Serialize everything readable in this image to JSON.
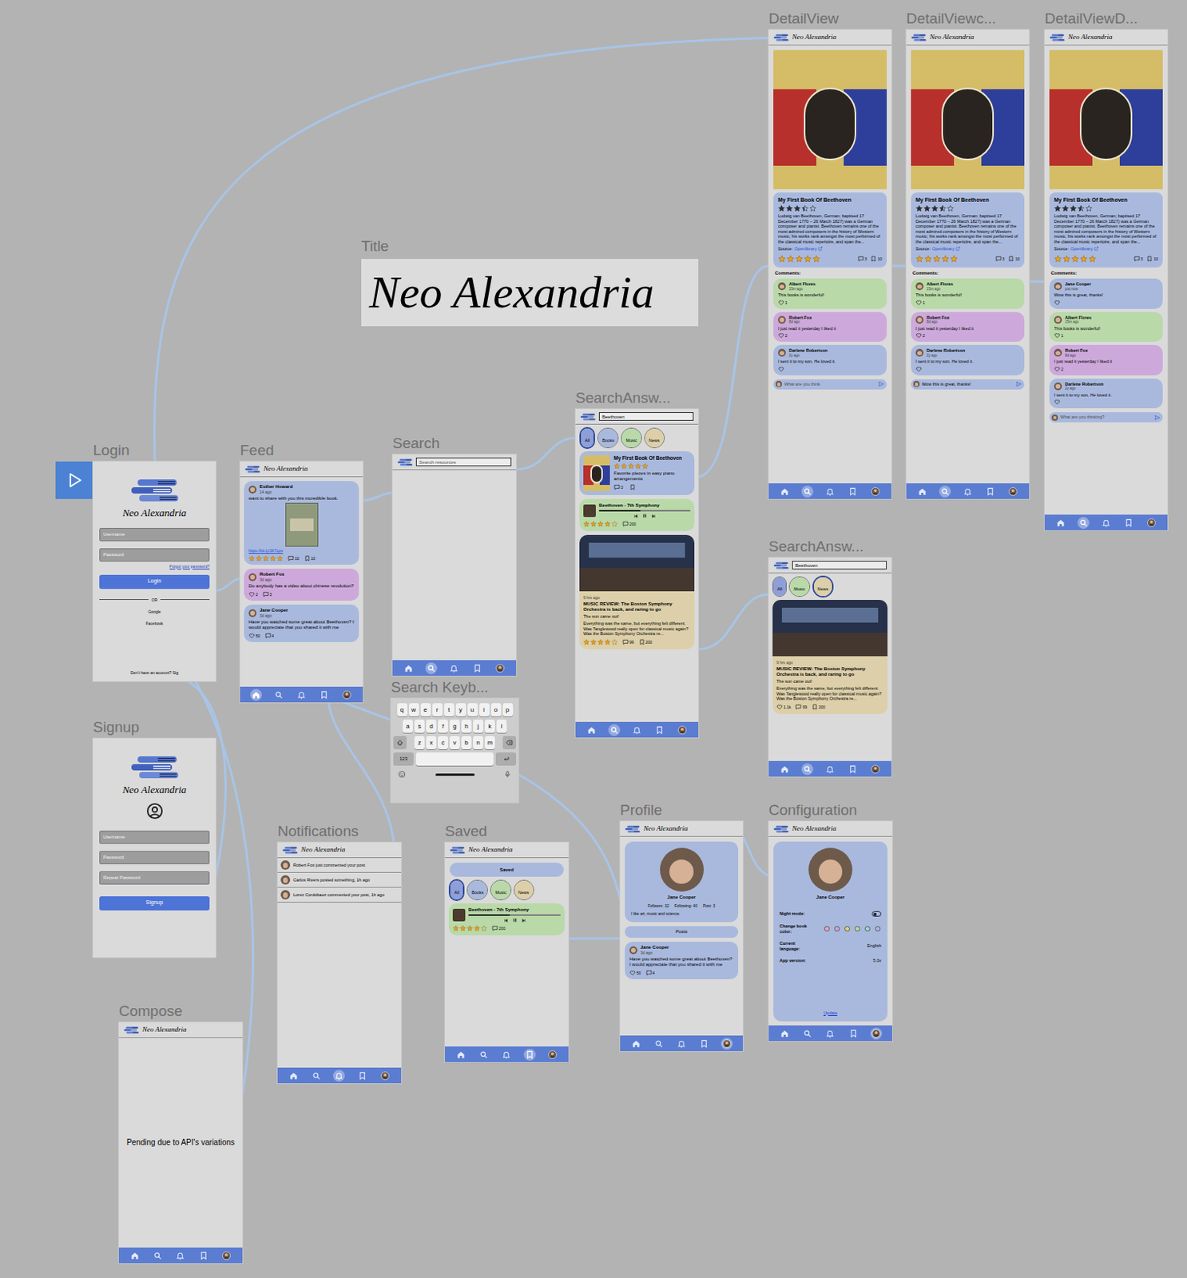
{
  "title": {
    "label": "Title",
    "text": "Neo Alexandria"
  },
  "brand": "Neo Alexandria",
  "frames": [
    {
      "kind": "login",
      "label": "Login",
      "fields": [
        "Username",
        "Password"
      ],
      "forgot": "Forgot your password?",
      "button": "Login",
      "divider": "OR",
      "providers": [
        "Google",
        "Facebook"
      ],
      "footer": "Don't have an account? Sig"
    },
    {
      "kind": "feed",
      "label": "Feed",
      "posts": [
        {
          "kind": "image",
          "author": "Esther Howard",
          "time": "14 ago",
          "text": "want to share with you this incredible book.",
          "link": "https://bit.ly/3KTqov",
          "stars": 5,
          "comments": "10",
          "saves": "10",
          "color": "#a9b9de"
        },
        {
          "kind": "text",
          "author": "Robert Fox",
          "time": "3d ago",
          "text": "Do anybody has a video about chinese revolution?",
          "likes": "2",
          "comments": "3",
          "color": "#cda9db"
        },
        {
          "kind": "text",
          "author": "Jane Cooper",
          "time": "3d ago",
          "text": "Have you watched some great about Beethoven? I would appreciate that you shared it with me",
          "likes": "50",
          "comments": "4",
          "color": "#a9b9de"
        }
      ],
      "nav": [
        {
          "kind": "home",
          "selected": true
        },
        {
          "kind": "search",
          "selected": false
        },
        {
          "kind": "bell",
          "selected": false
        },
        {
          "kind": "bookmark",
          "selected": false
        },
        {
          "kind": "profile",
          "selected": false
        }
      ]
    },
    {
      "kind": "search",
      "label": "Search",
      "placeholder": "Search resources",
      "nav": [
        {
          "kind": "home",
          "selected": false
        },
        {
          "kind": "search",
          "selected": true
        },
        {
          "kind": "bell",
          "selected": false
        },
        {
          "kind": "bookmark",
          "selected": false
        },
        {
          "kind": "profile",
          "selected": false
        }
      ]
    },
    {
      "kind": "keyboard",
      "label": "Search Keyb...",
      "rows": [
        [
          "q",
          "w",
          "e",
          "r",
          "t",
          "y",
          "u",
          "i",
          "o",
          "p"
        ],
        [
          "a",
          "s",
          "d",
          "f",
          "g",
          "h",
          "j",
          "k",
          "l"
        ],
        [
          "z",
          "x",
          "c",
          "v",
          "b",
          "n",
          "m"
        ]
      ],
      "numbers": "123"
    },
    {
      "kind": "results",
      "label": "SearchAnsw...",
      "query": "Beethoven",
      "filters": [
        {
          "label": "All",
          "selected": true,
          "color": "#8e9fd8"
        },
        {
          "label": "Books",
          "selected": false,
          "color": "#a9b9de"
        },
        {
          "label": "Music",
          "selected": false,
          "color": "#b9d9a9"
        },
        {
          "label": "News",
          "selected": false,
          "color": "#dccfa9"
        }
      ],
      "results": [
        {
          "kind": "book",
          "title": "My First Book Of Beethoven",
          "stars": 5,
          "subtitle": "Favorite pieces in easy piano arrangements",
          "comments": "3",
          "color": "#a9b9de"
        },
        {
          "kind": "music",
          "title": "Beethoven - 7th Symphony",
          "level": 0.45,
          "stars": 4,
          "comments": "200",
          "color": "#b9d9a9"
        },
        {
          "kind": "news",
          "time": "9 hrs ago",
          "title": "MUSIC REVIEW: The Boston Symphony Orchestra is back, and raring to go",
          "subtitle": "The sun came out!",
          "body": "Everything was the same, but everything felt different. Was Tanglewood really open for classical music again? Was the Boston Symphony Orchestra re...",
          "stars": 4,
          "comments": "99",
          "saves": "200",
          "color": "#dccfa9"
        }
      ],
      "nav": [
        {
          "kind": "home",
          "selected": false
        },
        {
          "kind": "search",
          "selected": true
        },
        {
          "kind": "bell",
          "selected": false
        },
        {
          "kind": "bookmark",
          "selected": false
        },
        {
          "kind": "profile",
          "selected": false
        }
      ]
    },
    {
      "kind": "detail",
      "label": "DetailView",
      "title": "My First Book Of Beethoven",
      "rating": 3.5,
      "description": "Ludwig van Beethoven, German; baptised 17 December 1770 – 26 March 1827) was a German composer and pianist. Beethoven remains one of the most admired composers in the history of Western music; his works rank amongst the most performed of the classical music repertoire, and span the...",
      "source_label": "Source:",
      "source": "Openlibrary",
      "my_stars": 5,
      "comments": "3",
      "saves": "10",
      "comments_label": "Comments:",
      "comment_list": [
        {
          "author": "Albert Flores",
          "time": "15m ago",
          "text": "This books is wonderful!",
          "likes": "1",
          "color": "#b9d9a9"
        },
        {
          "author": "Robert Fox",
          "time": "8d ago",
          "text": "I just read it yesterday I liked it",
          "likes": "2",
          "color": "#cda9db"
        },
        {
          "author": "Darlene Robertson",
          "time": "2y ago",
          "text": "I sent it to my son, He loved it.",
          "color": "#a9b9de"
        }
      ],
      "input": {
        "text": "What are you think",
        "placeholder": true
      },
      "nav": [
        {
          "kind": "home",
          "selected": false
        },
        {
          "kind": "search",
          "selected": true
        },
        {
          "kind": "bell",
          "selected": false
        },
        {
          "kind": "bookmark",
          "selected": false
        },
        {
          "kind": "profile",
          "selected": false
        }
      ]
    },
    {
      "kind": "detail",
      "label": "DetailViewc...",
      "title": "My First Book Of Beethoven",
      "rating": 3.5,
      "description": "Ludwig van Beethoven, German; baptised 17 December 1770 – 26 March 1827) was a German composer and pianist. Beethoven remains one of the most admired composers in the history of Western music; his works rank amongst the most performed of the classical music repertoire, and span the...",
      "source_label": "Source:",
      "source": "Openlibrary",
      "my_stars": 5,
      "comments": "3",
      "saves": "10",
      "comments_label": "Comments:",
      "comment_list": [
        {
          "author": "Albert Flores",
          "time": "15m ago",
          "text": "This books is wonderful!",
          "likes": "1",
          "color": "#b9d9a9"
        },
        {
          "author": "Robert Fox",
          "time": "8d ago",
          "text": "I just read it yesterday I liked it",
          "likes": "2",
          "color": "#cda9db"
        },
        {
          "author": "Darlene Robertson",
          "time": "2y ago",
          "text": "I sent it to my son, He loved it.",
          "color": "#a9b9de"
        }
      ],
      "input": {
        "text": "Wow this is great, thanks!",
        "placeholder": false
      },
      "nav": [
        {
          "kind": "home",
          "selected": false
        },
        {
          "kind": "search",
          "selected": true
        },
        {
          "kind": "bell",
          "selected": false
        },
        {
          "kind": "bookmark",
          "selected": false
        },
        {
          "kind": "profile",
          "selected": false
        }
      ]
    },
    {
      "kind": "detail",
      "label": "DetailViewD...",
      "title": "My First Book Of Beethoven",
      "rating": 3.5,
      "description": "Ludwig van Beethoven, German; baptised 17 December 1770 – 26 March 1827) was a German composer and pianist. Beethoven remains one of the most admired composers in the history of Western music; his works rank amongst the most performed of the classical music repertoire, and span the...",
      "source_label": "Source:",
      "source": "Openlibrary",
      "my_stars": 5,
      "comments": "3",
      "saves": "10",
      "comments_label": "Comments:",
      "comment_list": [
        {
          "author": "Jane Cooper",
          "time": "just now",
          "text": "Wow this is great, thanks!",
          "color": "#a9b9de"
        },
        {
          "author": "Albert Flores",
          "time": "15m ago",
          "text": "This books is wonderful!",
          "likes": "1",
          "color": "#b9d9a9"
        },
        {
          "author": "Robert Fox",
          "time": "8d ago",
          "text": "I just read it yesterday I liked it",
          "likes": "2",
          "color": "#cda9db"
        },
        {
          "author": "Darlene Robertson",
          "time": "2y ago",
          "text": "I sent it to my son, He loved it.",
          "color": "#a9b9de"
        }
      ],
      "input": {
        "text": "What are you thinking?",
        "placeholder": true
      },
      "nav": [
        {
          "kind": "home",
          "selected": false
        },
        {
          "kind": "search",
          "selected": true
        },
        {
          "kind": "bell",
          "selected": false
        },
        {
          "kind": "bookmark",
          "selected": false
        },
        {
          "kind": "profile",
          "selected": false
        }
      ]
    },
    {
      "kind": "results",
      "label": "SearchAnsw...",
      "query": "Beethoven",
      "filters": [
        {
          "label": "All",
          "selected": false,
          "color": "#8e9fd8"
        },
        {
          "label": "Music",
          "selected": false,
          "color": "#b9d9a9"
        },
        {
          "label": "News",
          "selected": true,
          "color": "#dccfa9"
        }
      ],
      "results": [
        {
          "kind": "news",
          "time": "9 hrs ago",
          "title": "MUSIC REVIEW: The Boston Symphony Orchestra is back, and raring to go",
          "subtitle": "The sun came out!",
          "body": "Everything was the same, but everything felt different. Was Tanglewood really open for classical music again? Was the Boston Symphony Orchestra re...",
          "likes": "1.1k",
          "comments": "99",
          "saves": "200",
          "color": "#dccfa9"
        }
      ],
      "nav": [
        {
          "kind": "home",
          "selected": false
        },
        {
          "kind": "search",
          "selected": true
        },
        {
          "kind": "bell",
          "selected": false
        },
        {
          "kind": "bookmark",
          "selected": false
        },
        {
          "kind": "profile",
          "selected": false
        }
      ]
    },
    {
      "kind": "signup",
      "label": "Signup",
      "fields": [
        "Username",
        "Password",
        "Repeat Password"
      ],
      "button": "Signup"
    },
    {
      "kind": "compose",
      "label": "Compose",
      "message": "Pending due to API's variations",
      "nav": [
        {
          "kind": "home",
          "selected": false
        },
        {
          "kind": "search",
          "selected": false
        },
        {
          "kind": "bell",
          "selected": false
        },
        {
          "kind": "bookmark",
          "selected": false
        },
        {
          "kind": "profile",
          "selected": false
        }
      ]
    },
    {
      "kind": "notifications",
      "label": "Notifications",
      "items": [
        {
          "text": "Robert Fox just commented your post"
        },
        {
          "text": "Carlos Rivers posted something, 1h ago"
        },
        {
          "text": "Lorez Cordobaez commented your post, 1h ago"
        }
      ],
      "nav": [
        {
          "kind": "home",
          "selected": false
        },
        {
          "kind": "search",
          "selected": false
        },
        {
          "kind": "bell",
          "selected": true
        },
        {
          "kind": "bookmark",
          "selected": false
        },
        {
          "kind": "profile",
          "selected": false
        }
      ]
    },
    {
      "kind": "saved",
      "label": "Saved",
      "heading": "Saved",
      "filters": [
        {
          "label": "All",
          "selected": true,
          "color": "#8e9fd8"
        },
        {
          "label": "Books",
          "selected": false,
          "color": "#a9b9de"
        },
        {
          "label": "Music",
          "selected": false,
          "color": "#b9d9a9"
        },
        {
          "label": "News",
          "selected": false,
          "color": "#dccfa9"
        }
      ],
      "items": [
        {
          "kind": "music",
          "title": "Beethoven - 7th Symphony",
          "level": 0.45,
          "stars": 4,
          "comments": "200",
          "color": "#b9d9a9"
        }
      ],
      "nav": [
        {
          "kind": "home",
          "selected": false
        },
        {
          "kind": "search",
          "selected": false
        },
        {
          "kind": "bell",
          "selected": false
        },
        {
          "kind": "bookmark",
          "selected": true
        },
        {
          "kind": "profile",
          "selected": false
        }
      ]
    },
    {
      "kind": "profile",
      "label": "Profile",
      "name": "Jane Cooper",
      "stats": [
        "Follwers: 32",
        "Following: 40",
        "Post: 3"
      ],
      "bio": "I like art, music and science.",
      "section": "Posts",
      "posts": [
        {
          "kind": "text",
          "author": "Jane Cooper",
          "time": "3d ago",
          "text": "Have you watched some great about Beethoven? I would appreciate that you shared it with me",
          "likes": "50",
          "comments": "4",
          "color": "#a9b9de"
        }
      ],
      "nav": [
        {
          "kind": "home",
          "selected": false
        },
        {
          "kind": "search",
          "selected": false
        },
        {
          "kind": "bell",
          "selected": false
        },
        {
          "kind": "bookmark",
          "selected": false
        },
        {
          "kind": "profile",
          "selected": true
        }
      ]
    },
    {
      "kind": "configuration",
      "label": "Configuration",
      "name": "Jane Cooper",
      "night_mode": {
        "label": "Night mode:",
        "on": false
      },
      "book_color": {
        "label": "Change book color:",
        "options": [
          {
            "color": "#e8a7c8",
            "selected": false
          },
          {
            "color": "#c9a8e0",
            "selected": false
          },
          {
            "color": "#e6d27a",
            "selected": false
          },
          {
            "color": "#b7dca0",
            "selected": false
          },
          {
            "color": "#9fd6cf",
            "selected": false
          },
          {
            "color": "#a9b9de",
            "selected": false
          }
        ]
      },
      "language": {
        "label": "Current language:",
        "value": "English"
      },
      "version": {
        "label": "App version:",
        "value": "5.0v"
      },
      "update": "Update",
      "nav": [
        {
          "kind": "home",
          "selected": false
        },
        {
          "kind": "search",
          "selected": false
        },
        {
          "kind": "bell",
          "selected": false
        },
        {
          "kind": "bookmark",
          "selected": false
        },
        {
          "kind": "profile",
          "selected": true
        }
      ]
    }
  ]
}
